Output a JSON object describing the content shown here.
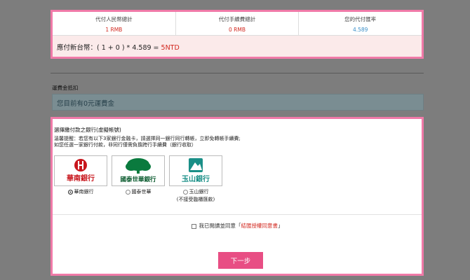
{
  "summary": {
    "cols": [
      {
        "label": "代付人民幣總計",
        "value": "1 RMB"
      },
      {
        "label": "代付手續費總計",
        "value": "0 RMB"
      },
      {
        "label": "您的代付匯率",
        "value": "4.589"
      }
    ],
    "formula_prefix": "應付新台幣：( 1 + 0 ) * 4.589 = ",
    "formula_total": "5NTD"
  },
  "rebate": {
    "title": "運費金抵扣",
    "message": "您目前有0元運費金"
  },
  "banks": {
    "title": "選擇繳付款之銀行(虛擬帳號)",
    "notice": [
      "溫馨提醒：若您有以下3家銀行金融卡，請選擇同一銀行同行轉帳，立即免轉帳手續費;",
      "如您任選一家銀行付款，非同行僅需負擔跨行手續費（銀行收取）"
    ],
    "items": [
      {
        "label": "華南銀行",
        "selected": true,
        "logo_text": "華南銀行",
        "color": "#c8161d"
      },
      {
        "label": "國泰世華",
        "selected": false,
        "logo_text": "國泰世華銀行",
        "color": "#0a7a3e"
      },
      {
        "label": "玉山銀行",
        "selected": false,
        "logo_text": "玉山銀行",
        "sub": "(不接受臨櫃匯款)",
        "color": "#1a8f87"
      }
    ]
  },
  "agree": {
    "prefix": "我已閱讀並同意「",
    "link": "結匯授權同意書",
    "suffix": "」"
  },
  "next_label": "下一步"
}
